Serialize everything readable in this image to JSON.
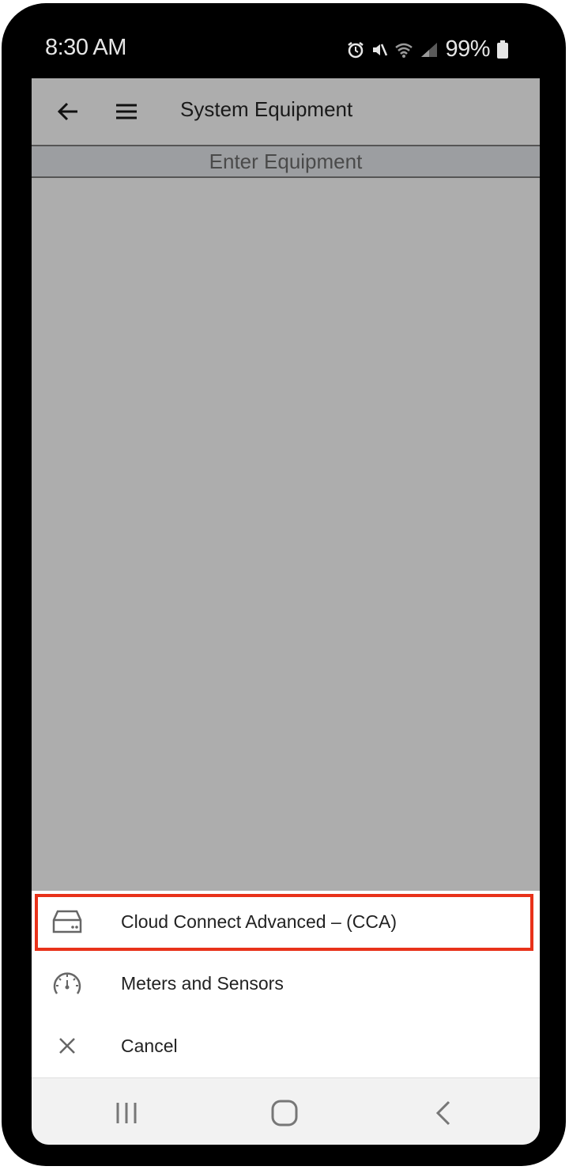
{
  "status_bar": {
    "time": "8:30 AM",
    "battery": "99%"
  },
  "app_bar": {
    "title": "System Equipment"
  },
  "sub_header": {
    "label": "Enter Equipment"
  },
  "bottom_sheet": {
    "items": [
      {
        "label": "Cloud Connect Advanced – (CCA)",
        "icon": "device-icon",
        "highlighted": true
      },
      {
        "label": "Meters and Sensors",
        "icon": "gauge-icon",
        "highlighted": false
      },
      {
        "label": "Cancel",
        "icon": "close-icon",
        "highlighted": false
      }
    ]
  },
  "colors": {
    "scrim": "#adadad",
    "sub_header_bg": "#9c9ea1",
    "highlight": "#e8321a",
    "sheet_bg": "#ffffff",
    "nav_bg": "#f2f2f2"
  }
}
